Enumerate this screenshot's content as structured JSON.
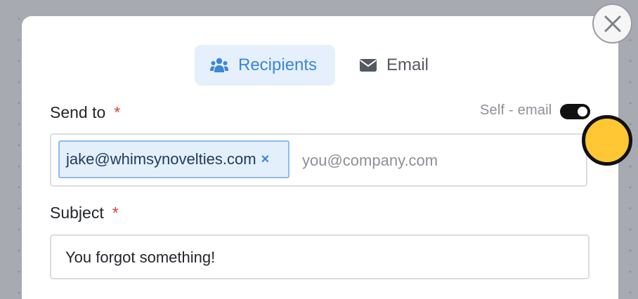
{
  "tabs": [
    {
      "label": "Recipients",
      "icon": "users-icon",
      "active": true
    },
    {
      "label": "Email",
      "icon": "envelope-icon",
      "active": false
    }
  ],
  "send_to": {
    "label": "Send to",
    "required_mark": "*",
    "self_email_label": "Self - email",
    "self_email_enabled": true,
    "recipients": [
      "jake@whimsynovelties.com"
    ],
    "chip_remove": "×",
    "placeholder": "you@company.com"
  },
  "subject": {
    "label": "Subject",
    "required_mark": "*",
    "value": "You forgot something!"
  },
  "colors": {
    "accent": "#3d86d8",
    "required": "#e23b3b",
    "cursor": "#fec733"
  }
}
